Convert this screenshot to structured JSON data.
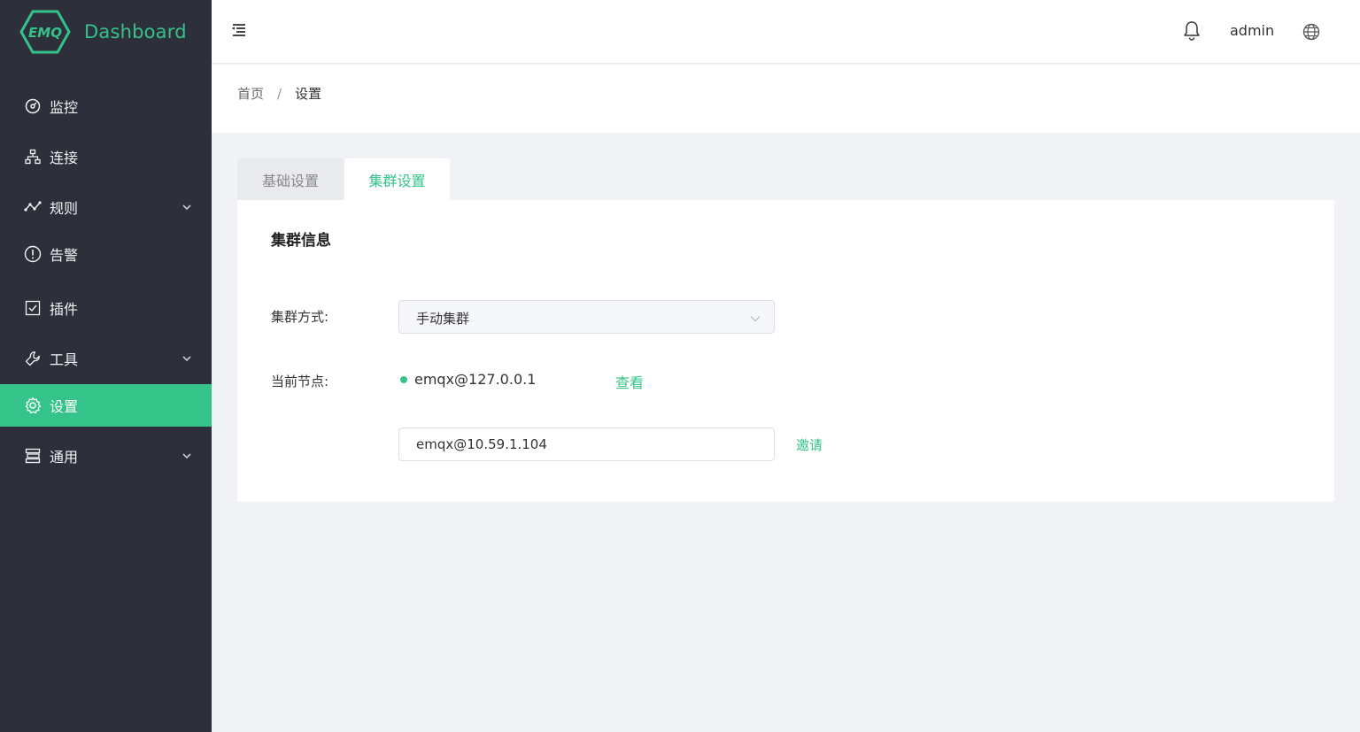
{
  "app": {
    "logo_text": "EMQ",
    "title": "Dashboard",
    "brand_color": "#34c388",
    "sidebar_bg": "#2d2f3b"
  },
  "sidebar": {
    "items": [
      {
        "label": "监控",
        "icon": "gauge-icon",
        "has_submenu": false,
        "active": false
      },
      {
        "label": "连接",
        "icon": "network-icon",
        "has_submenu": false,
        "active": false
      },
      {
        "label": "规则",
        "icon": "rule-flow-icon",
        "has_submenu": true,
        "active": false
      },
      {
        "label": "告警",
        "icon": "alert-circle-icon",
        "has_submenu": false,
        "active": false
      },
      {
        "label": "插件",
        "icon": "checkbox-icon",
        "has_submenu": false,
        "active": false
      },
      {
        "label": "工具",
        "icon": "wrench-icon",
        "has_submenu": true,
        "active": false
      },
      {
        "label": "设置",
        "icon": "gear-icon",
        "has_submenu": false,
        "active": true
      },
      {
        "label": "通用",
        "icon": "server-icon",
        "has_submenu": true,
        "active": false
      }
    ]
  },
  "header": {
    "user": "admin"
  },
  "breadcrumb": {
    "home": "首页",
    "separator": "/",
    "current": "设置"
  },
  "tabs": [
    {
      "label": "基础设置",
      "active": false
    },
    {
      "label": "集群设置",
      "active": true
    }
  ],
  "cluster": {
    "title": "集群信息",
    "mode_label": "集群方式:",
    "mode_value": "手动集群",
    "node_label": "当前节点:",
    "node_value": "emqx@127.0.0.1",
    "node_status_color": "#34c388",
    "view_link": "查看",
    "invite_input_value": "emqx@10.59.1.104",
    "invite_link": "邀请"
  }
}
